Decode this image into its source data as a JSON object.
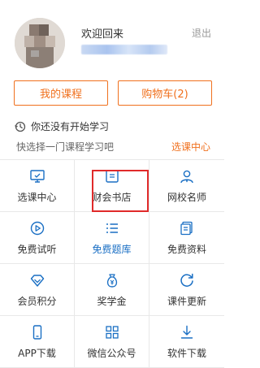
{
  "header": {
    "welcome": "欢迎回来",
    "logout": "退出"
  },
  "buttons": {
    "my_courses": "我的课程",
    "cart": "购物车(2)"
  },
  "status": {
    "text": "你还没有开始学习",
    "hint": "快选择一门课程学习吧",
    "select_link": "选课中心"
  },
  "grid": [
    {
      "label": "选课中心",
      "icon": "monitor-icon"
    },
    {
      "label": "财会书店",
      "icon": "book-icon"
    },
    {
      "label": "网校名师",
      "icon": "teacher-icon"
    },
    {
      "label": "免费试听",
      "icon": "play-icon"
    },
    {
      "label": "免费题库",
      "icon": "list-icon"
    },
    {
      "label": "免费资料",
      "icon": "documents-icon"
    },
    {
      "label": "会员积分",
      "icon": "diamond-icon"
    },
    {
      "label": "奖学金",
      "icon": "money-bag-icon"
    },
    {
      "label": "课件更新",
      "icon": "refresh-icon"
    },
    {
      "label": "APP下载",
      "icon": "phone-icon"
    },
    {
      "label": "微信公众号",
      "icon": "qr-grid-icon"
    },
    {
      "label": "软件下载",
      "icon": "download-icon"
    }
  ],
  "colors": {
    "accent_orange": "#f0701d",
    "icon_blue": "#1a6fc4",
    "highlight_red": "#e02a2a"
  }
}
